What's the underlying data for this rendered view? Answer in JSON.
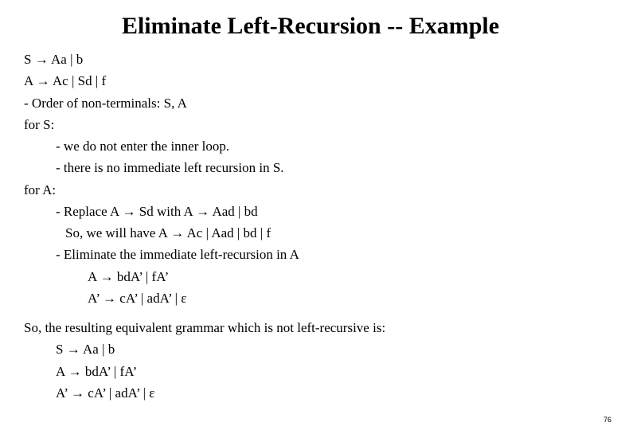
{
  "title": "Eliminate Left-Recursion -- Example",
  "grammar": {
    "s": "S → Aa | b",
    "a": "A → Ac | Sd | f"
  },
  "order": "- Order of non-terminals: S, A",
  "forS": {
    "head": "for S:",
    "l1": "- we do not enter the inner loop.",
    "l2": "- there is no immediate left recursion in S."
  },
  "forA": {
    "head": "for A:",
    "l1": "- Replace A → Sd   with   A → Aad | bd",
    "l2": "So, we will have   A → Ac | Aad | bd | f",
    "l3": "- Eliminate the immediate left-recursion in A",
    "l4": "A → bdA’ | fA’",
    "l5": "A’ → cA’ |  adA’ | ε"
  },
  "result": {
    "head": "So, the resulting equivalent grammar which is not left-recursive is:",
    "l1": "S → Aa | b",
    "l2": "A → bdA’ | fA’",
    "l3": "A’ → cA’ |  adA’ | ε"
  },
  "page": "76"
}
